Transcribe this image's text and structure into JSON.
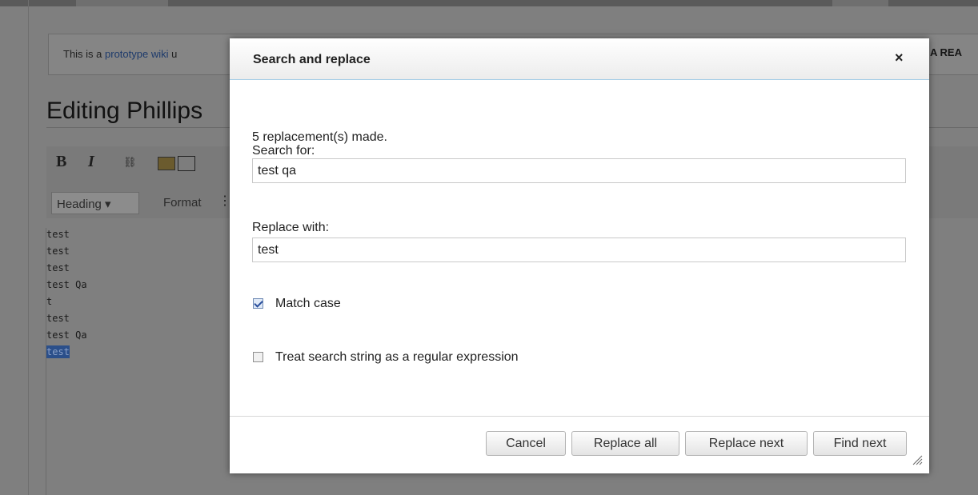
{
  "background": {
    "notice": {
      "prefix": "This is a ",
      "link": "prototype wiki",
      "suffix": " u",
      "right_text": "A REA"
    },
    "page_heading": "Editing Phillips",
    "toolbar": {
      "bold": "B",
      "italic": "I",
      "link_icon": "link-icon",
      "heading_select": "Heading ▾",
      "format_label": "Format",
      "more_icon": "⋮"
    },
    "editor_lines": [
      "test",
      "test",
      "test",
      "test Qa",
      "t",
      "test",
      "test Qa",
      "test"
    ]
  },
  "dialog": {
    "title": "Search and replace",
    "close_glyph": "×",
    "status": "5 replacement(s) made.",
    "search_label": "Search for:",
    "search_value": "test qa",
    "replace_label": "Replace with:",
    "replace_value": "test",
    "match_case_label": "Match case",
    "match_case_checked": true,
    "regex_label": "Treat search string as a regular expression",
    "regex_checked": false,
    "buttons": {
      "cancel": "Cancel",
      "replace_all": "Replace all",
      "replace_next": "Replace next",
      "find_next": "Find next"
    },
    "colors": {
      "header_border": "#a8cfe6",
      "selection": "#2b4f8a"
    }
  }
}
